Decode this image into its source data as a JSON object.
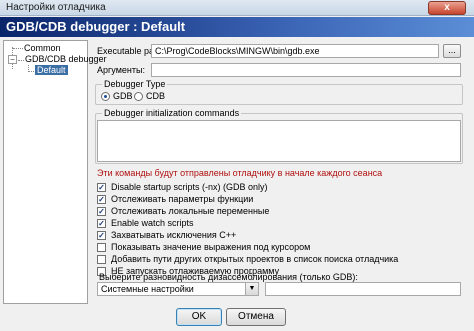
{
  "window": {
    "title": "Настройки отладчика",
    "close_glyph": "x"
  },
  "header": {
    "title": "GDB/CDB debugger : Default"
  },
  "tree": {
    "items": [
      {
        "label": "Common"
      },
      {
        "label": "GDB/CDB debugger"
      },
      {
        "label": "Default"
      }
    ],
    "expander_glyph": "−"
  },
  "form": {
    "executable_label": "Executable path:",
    "executable_value": "C:\\Prog\\CodeBlocks\\MINGW\\bin\\gdb.exe",
    "browse_label": "...",
    "args_label": "Аргументы:",
    "args_value": "",
    "debugger_type": {
      "label": "Debugger Type",
      "options": [
        "GDB",
        "CDB"
      ],
      "selected": "GDB"
    },
    "init_commands_label": "Debugger initialization commands",
    "init_commands_value": "",
    "warning": "Эти команды будут отправлены отладчику в начале каждого сеанса",
    "checkboxes": [
      {
        "label": "Disable startup scripts (-nx) (GDB only)",
        "checked": true
      },
      {
        "label": "Отслеживать параметры функции",
        "checked": true
      },
      {
        "label": "Отслеживать локальные переменные",
        "checked": true
      },
      {
        "label": "Enable watch scripts",
        "checked": true
      },
      {
        "label": "Захватывать исключения C++",
        "checked": true
      },
      {
        "label": "Показывать значение выражения под курсором",
        "checked": false
      },
      {
        "label": "Добавить пути других открытых проектов в список поиска отладчика",
        "checked": false
      },
      {
        "label": "НЕ запускать отлаживаемую программу",
        "checked": false
      }
    ],
    "disasm": {
      "label": "Выберите разновидность дизассемблирования (только GDB):",
      "selected": "Системные настройки",
      "extra_value": ""
    }
  },
  "buttons": {
    "ok": "OK",
    "cancel": "Отмена"
  },
  "check_glyph": "✓",
  "colors": {
    "header_start": "#0a246a",
    "header_end": "#5b8ed6",
    "warning": "#b01010",
    "selection": "#3a6ea5"
  }
}
